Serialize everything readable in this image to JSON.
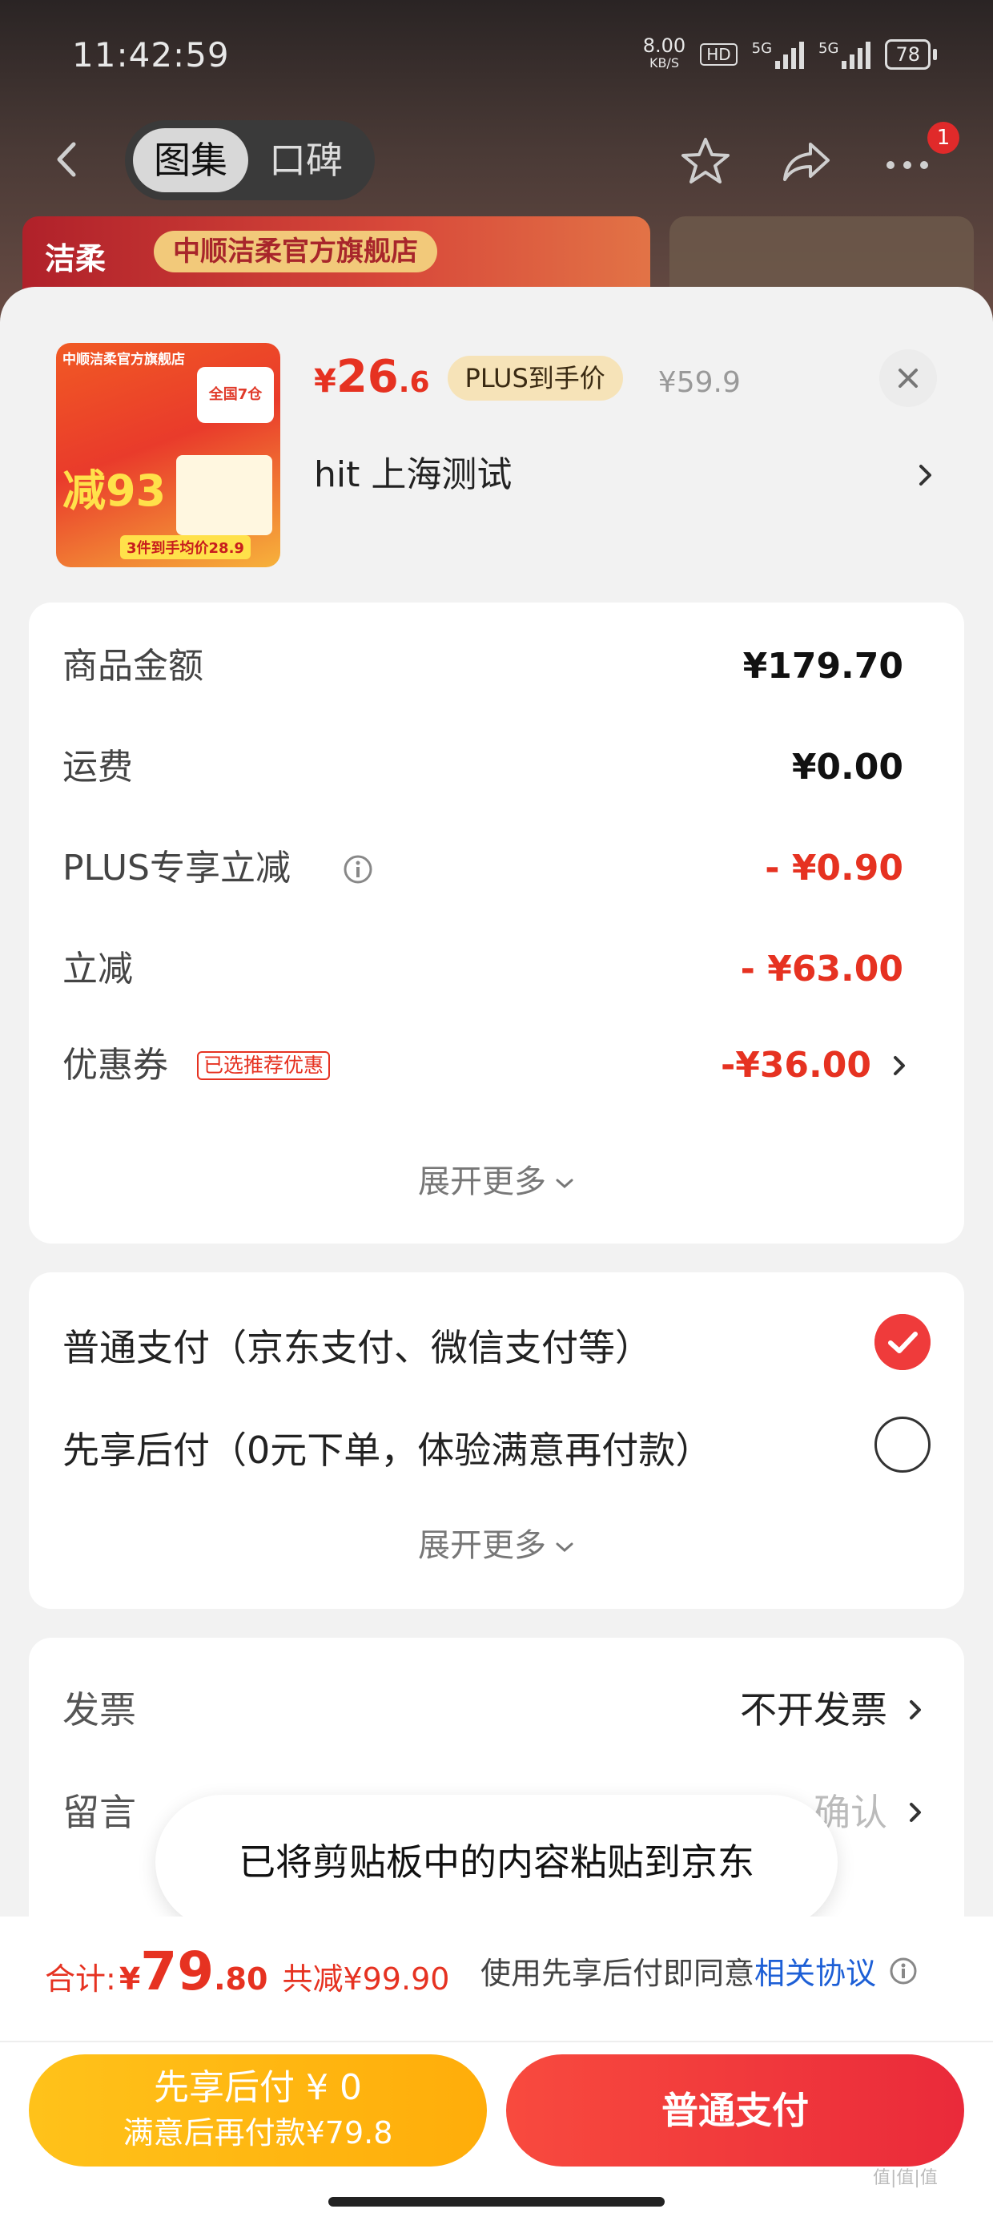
{
  "status_bar": {
    "time": "11:42:59",
    "net_speed_value": "8.00",
    "net_speed_unit": "KB/S",
    "hd_label": "HD",
    "signal1_label": "5G",
    "signal2_label": "5G",
    "battery": "78"
  },
  "nav": {
    "tabs": [
      {
        "label": "图集",
        "active": true
      },
      {
        "label": "口碑",
        "active": false
      }
    ],
    "notification_count": "1",
    "store_name": "中顺洁柔官方旗舰店",
    "store_logo": "洁柔"
  },
  "product": {
    "thumb_texts": {
      "top": "中顺洁柔官方旗舰店",
      "tag": "全国7仓",
      "big": "减93",
      "bottom": "3件到手均价28.9"
    },
    "price_symbol": "¥",
    "price_integer": "26",
    "price_decimal": ".6",
    "plus_badge": "PLUS到手价",
    "original_price": "¥59.9",
    "address": "hit  上海测试"
  },
  "fees": {
    "rows": [
      {
        "label": "商品金额",
        "value": "¥179.70",
        "red": false
      },
      {
        "label": "运费",
        "value": "¥0.00",
        "red": false
      },
      {
        "label": "PLUS专享立减",
        "value": "- ¥0.90",
        "red": true
      },
      {
        "label": "立减",
        "value": "- ¥63.00",
        "red": true
      },
      {
        "label": "优惠券",
        "value": "-¥36.00",
        "red": true
      }
    ],
    "coupon_tag": "已选推荐优惠",
    "expand_label": "展开更多"
  },
  "payment": {
    "options": [
      {
        "label": "普通支付（京东支付、微信支付等）",
        "selected": true
      },
      {
        "label": "先享后付（0元下单，体验满意再付款）",
        "selected": false
      }
    ],
    "expand_label": "展开更多"
  },
  "misc": {
    "invoice_label": "发票",
    "invoice_value": "不开发票",
    "note_label": "留言",
    "note_value": "确认"
  },
  "toast": "已将剪贴板中的内容粘贴到京东",
  "footer": {
    "total_label": "合计:",
    "total_symbol": "¥",
    "total_integer": "79",
    "total_decimal": ".80",
    "saved": "共减¥99.90",
    "agree_prefix": "使用先享后付即同意",
    "agree_link": "相关协议",
    "later_line1": "先享后付 ¥ 0",
    "later_line2": "满意后再付款¥79.8",
    "pay_label": "普通支付"
  },
  "watermark": "值|值|值",
  "colors": {
    "accent_red": "#e63221",
    "plus_gold": "#f6e3b8",
    "later_yellow": "#ffb40f",
    "link_blue": "#1d5fd6"
  }
}
